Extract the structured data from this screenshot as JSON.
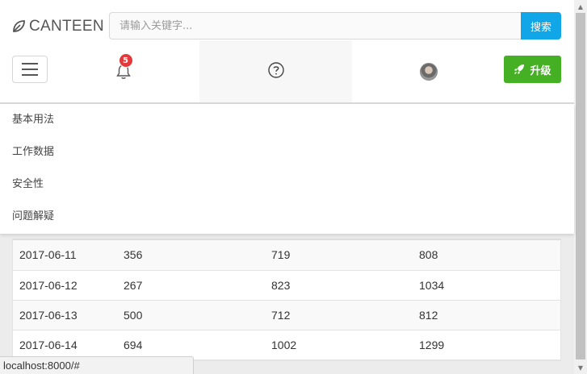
{
  "header": {
    "logo_text": "CANTEEN",
    "search": {
      "placeholder": "请输入关键字...",
      "value": "",
      "button_label": "搜索"
    },
    "notifications_count": "5",
    "upgrade_label": "升级",
    "colors": {
      "search_button": "#10a6e8",
      "upgrade_button": "#46b024",
      "badge": "#e4393c"
    }
  },
  "dropdown": {
    "items": [
      {
        "label": "基本用法"
      },
      {
        "label": "工作数据"
      },
      {
        "label": "安全性"
      },
      {
        "label": "问题解疑"
      }
    ]
  },
  "table": {
    "rows": [
      [
        "2017-06-11",
        "356",
        "719",
        "808"
      ],
      [
        "2017-06-12",
        "267",
        "823",
        "1034"
      ],
      [
        "2017-06-13",
        "500",
        "712",
        "812"
      ],
      [
        "2017-06-14",
        "694",
        "1002",
        "1299"
      ]
    ]
  },
  "statusbar": {
    "url": "localhost:8000/#"
  },
  "icons": [
    "leaf-logo-icon",
    "menu-icon",
    "bell-icon",
    "help-icon",
    "avatar",
    "rocket-icon"
  ]
}
